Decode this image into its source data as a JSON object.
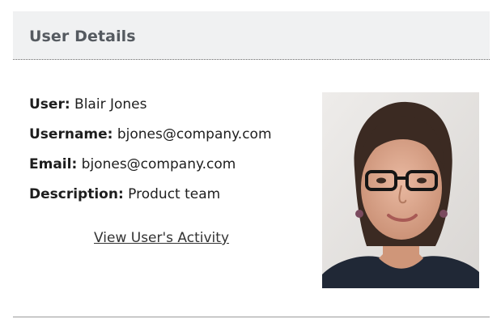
{
  "panel": {
    "title": "User Details"
  },
  "user": {
    "user_label": "User:",
    "user_value": "Blair Jones",
    "username_label": "Username:",
    "username_value": "bjones@company.com",
    "email_label": "Email:",
    "email_value": "bjones@company.com",
    "description_label": "Description:",
    "description_value": "Product team"
  },
  "actions": {
    "view_activity_label": "View User's Activity"
  },
  "photo": {
    "icon": "user-photo"
  },
  "colors": {
    "header_bg": "#f0f1f2",
    "title_text": "#555a60",
    "body_text": "#1e1e1e"
  }
}
